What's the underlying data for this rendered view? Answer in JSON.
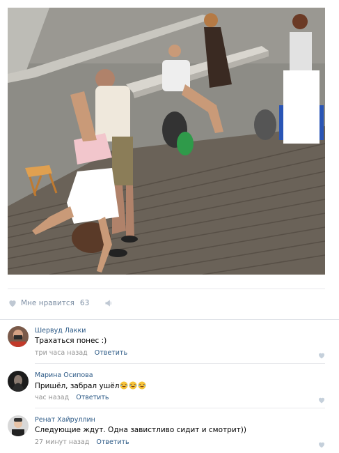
{
  "post": {
    "photo_alt": "photo"
  },
  "likes": {
    "label": "Мне нравится",
    "count": "63",
    "heart_icon": "heart-icon",
    "share_icon": "megaphone-icon",
    "icon_color": "#bfc8d3"
  },
  "comments": [
    {
      "author": "Шервуд Лакки",
      "text": "Трахаться понес :)",
      "time": "три часа назад",
      "reply": "Ответить",
      "emoji_count": 0
    },
    {
      "author": "Марина Осипова",
      "text": "Пришёл, забрал ушёл",
      "time": "час назад",
      "reply": "Ответить",
      "emoji_count": 3
    },
    {
      "author": "Ренат Хайруллин",
      "text": "Следующие ждут. Одна завистливо сидит и смотрит))",
      "time": "27 минут назад",
      "reply": "Ответить",
      "emoji_count": 0
    }
  ],
  "colors": {
    "link": "#2a5885",
    "muted": "#939393",
    "like_muted": "#7c8ea3",
    "separator": "#e7e8ec"
  }
}
